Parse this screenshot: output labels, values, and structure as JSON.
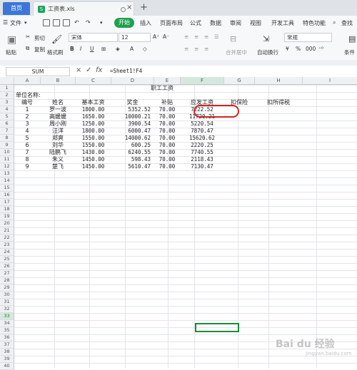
{
  "titlebar": {
    "home_tab": "首页",
    "file_tab": "工资表.xls",
    "file_icon": "S",
    "new_tab": "+"
  },
  "menubar": {
    "file_menu": "文件",
    "items": [
      "开始",
      "插入",
      "页面布局",
      "公式",
      "数据",
      "审阅",
      "视图",
      "开发工具",
      "特色功能",
      "查找"
    ]
  },
  "ribbon": {
    "cut": "剪切",
    "copy": "复制",
    "paste": "粘贴",
    "format_painter": "格式刷",
    "font_name": "宋体",
    "font_size": "12",
    "merge_center": "合并居中",
    "wrap_text": "自动换行",
    "number_format": "常规",
    "conditional": "条件"
  },
  "formula_bar": {
    "name_box": "SUM",
    "cancel": "×",
    "confirm": "✓",
    "fx": "fx",
    "formula": "=Sheet1!F4"
  },
  "columns": [
    "A",
    "B",
    "C",
    "D",
    "E",
    "F",
    "G",
    "H",
    "I"
  ],
  "rows": [
    "1",
    "2",
    "3",
    "4",
    "5",
    "6",
    "7",
    "8",
    "9",
    "10",
    "11",
    "12",
    "13",
    "14",
    "15",
    "16",
    "17",
    "18",
    "19",
    "20",
    "21",
    "22",
    "23",
    "24",
    "25",
    "26",
    "27",
    "28",
    "29",
    "30",
    "31",
    "32",
    "33",
    "34",
    "35",
    "36",
    "37",
    "38",
    "39",
    "40"
  ],
  "sheet": {
    "title": "职工工资",
    "unit_label": "单位名称:",
    "headers": [
      "编号",
      "姓名",
      "基本工资",
      "奖金",
      "补贴",
      "应发工资",
      "扣保险",
      "扣所得税"
    ],
    "data": [
      [
        "1",
        "罗一波",
        "1800.00",
        "5352.52",
        "70.00",
        "7222.52"
      ],
      [
        "2",
        "高媛媛",
        "1650.00",
        "10000.21",
        "70.00",
        "11720.21"
      ],
      [
        "3",
        "周小刚",
        "1250.00",
        "3900.54",
        "70.00",
        "5220.54"
      ],
      [
        "4",
        "汪洋",
        "1800.00",
        "6000.47",
        "70.00",
        "7870.47"
      ],
      [
        "5",
        "郑爽",
        "1550.00",
        "14000.62",
        "70.00",
        "15620.62"
      ],
      [
        "6",
        "刘华",
        "1550.00",
        "600.25",
        "70.00",
        "2220.25"
      ],
      [
        "7",
        "陆鹏飞",
        "1430.00",
        "6240.55",
        "70.00",
        "7740.55"
      ],
      [
        "8",
        "朱义",
        "1450.00",
        "598.43",
        "70.00",
        "2118.43"
      ],
      [
        "9",
        "楚飞",
        "1450.00",
        "5610.47",
        "70.00",
        "7130.47"
      ]
    ]
  },
  "watermark": {
    "brand": "Bai du 经验",
    "sub": "jingyan.baidu.com"
  },
  "colors": {
    "accent_green": "#1fa04f",
    "highlight_red": "#d22525",
    "home_blue": "#3c77d8"
  }
}
